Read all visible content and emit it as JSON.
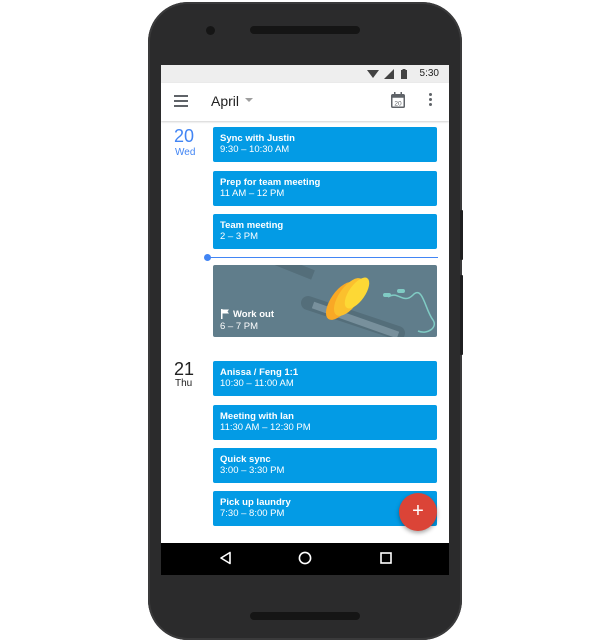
{
  "status_bar": {
    "time": "5:30"
  },
  "app_bar": {
    "month": "April",
    "today_icon_day": "20"
  },
  "days": [
    {
      "number": "20",
      "weekday": "Wed",
      "events": [
        {
          "title": "Sync with Justin",
          "time": "9:30 – 10:30 AM"
        },
        {
          "title": "Prep for team meeting",
          "time": "11 AM – 12 PM"
        },
        {
          "title": "Team meeting",
          "time": "2 – 3 PM"
        },
        {
          "title": "Work out",
          "time": "6 – 7 PM"
        }
      ]
    },
    {
      "number": "21",
      "weekday": "Thu",
      "events": [
        {
          "title": "Anissa / Feng 1:1",
          "time": "10:30 – 11:00 AM"
        },
        {
          "title": "Meeting with Ian",
          "time": "11:30 AM – 12:30 PM"
        },
        {
          "title": "Quick sync",
          "time": "3:00 – 3:30 PM"
        },
        {
          "title": "Pick up laundry",
          "time": "7:30 – 8:00 PM"
        }
      ]
    }
  ],
  "fab": {
    "label": "+"
  },
  "colors": {
    "event": "#039be5",
    "today": "#4285f4",
    "fab": "#db4437",
    "workout_bg": "#607d8b",
    "dumbbell": "#fbc02d"
  },
  "icons": {
    "menu": "menu-icon",
    "dropdown": "chevron-down-icon",
    "today": "calendar-today-icon",
    "overflow": "more-vert-icon",
    "flag": "flag-icon",
    "fab": "add-icon",
    "back": "back-triangle-icon",
    "home": "home-circle-icon",
    "recents": "recents-square-icon",
    "wifi": "wifi-icon",
    "signal": "signal-icon",
    "battery": "battery-icon"
  }
}
